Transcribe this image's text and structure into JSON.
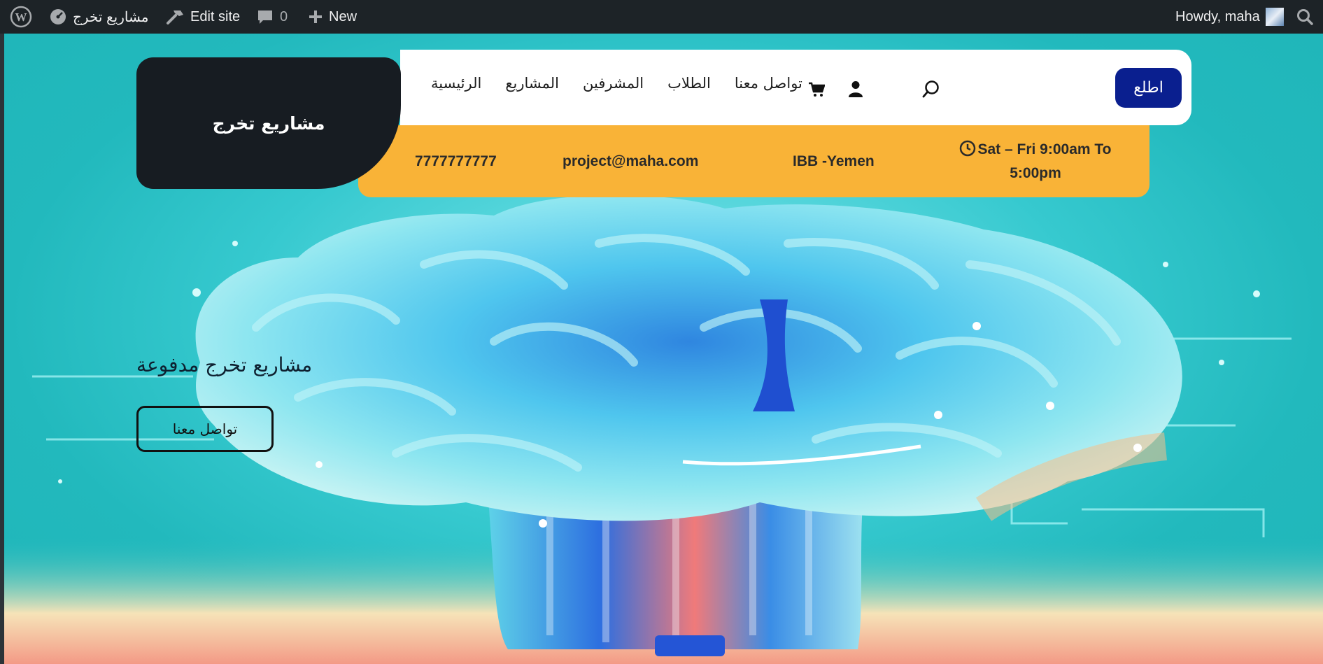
{
  "adminbar": {
    "site_name": "مشاريع تخرج",
    "edit_site": "Edit site",
    "comments_count": "0",
    "new_label": "New",
    "greeting": "Howdy, maha"
  },
  "header": {
    "logo_text": "مشاريع تخرج",
    "cta_label": "اطلع",
    "menu": [
      {
        "label": "تواصل معنا"
      },
      {
        "label": "الطلاب"
      },
      {
        "label": "المشرفين"
      },
      {
        "label": "المشاريع"
      },
      {
        "label": "الرئيسية"
      }
    ]
  },
  "infobar": {
    "phone": "7777777777",
    "email": "project@maha.com",
    "location": "IBB -Yemen",
    "hours_line1": "Sat – Fri 9:00am To",
    "hours_line2": "5:00pm"
  },
  "hero": {
    "title": "مشاريع تخرج مدفوعة",
    "button_label": "تواصل معنا"
  },
  "colors": {
    "adminbar": "#1d2327",
    "logo_bg": "#171c22",
    "cta": "#0a1f8f",
    "infobar": "#f9b337",
    "hero_bg": "#2bbfc2"
  }
}
